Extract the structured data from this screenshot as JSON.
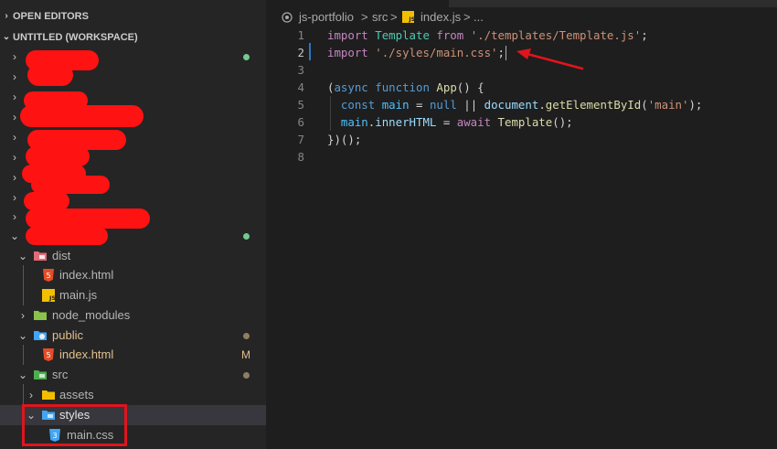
{
  "sidebar": {
    "open_editors": "OPEN EDITORS",
    "workspace": "UNTITLED (WORKSPACE)",
    "tree": {
      "dist": "dist",
      "dist_index": "index.html",
      "dist_main": "main.js",
      "node_modules": "node_modules",
      "public": "public",
      "public_index": "index.html",
      "public_index_status": "M",
      "src": "src",
      "assets": "assets",
      "styles": "styles",
      "main_css": "main.css"
    }
  },
  "editor": {
    "breadcrumb": {
      "project": "js-portfolio",
      "sep1": ">",
      "folder": "src",
      "sep2": ">",
      "file": "index.js",
      "sep3": ">",
      "more": "..."
    },
    "line_numbers": [
      "1",
      "2",
      "3",
      "4",
      "5",
      "6",
      "7",
      "8"
    ],
    "code": {
      "l1": {
        "kw": "import",
        "cls": "Template",
        "kw2": "from",
        "str": "'./templates/Template.js'",
        "end": ";"
      },
      "l2": {
        "kw": "import",
        "str": "'./syles/main.css'",
        "end": ";"
      },
      "l4": {
        "p1": "(",
        "kw": "async",
        "kw2": "function",
        "fn": "App",
        "p2": "() {"
      },
      "l5": {
        "kw": "const",
        "var": "main",
        "op": " = ",
        "null": "null",
        "or": " || ",
        "obj": "document",
        "dot": ".",
        "fn": "getElementById",
        "p1": "(",
        "str": "'main'",
        "p2": ");"
      },
      "l6": {
        "var": "main",
        "dot": ".",
        "prop": "innerHTML",
        "op": " = ",
        "kw": "await",
        "fn": "Template",
        "p": "();"
      },
      "l7": {
        "text": "})();"
      }
    }
  },
  "colors": {
    "annotation_red": "#e0141d",
    "folder_blue": "#42a5f5",
    "html_orange": "#e44d26",
    "js_yellow": "#f1bf00",
    "css_blue": "#42a5f5"
  }
}
